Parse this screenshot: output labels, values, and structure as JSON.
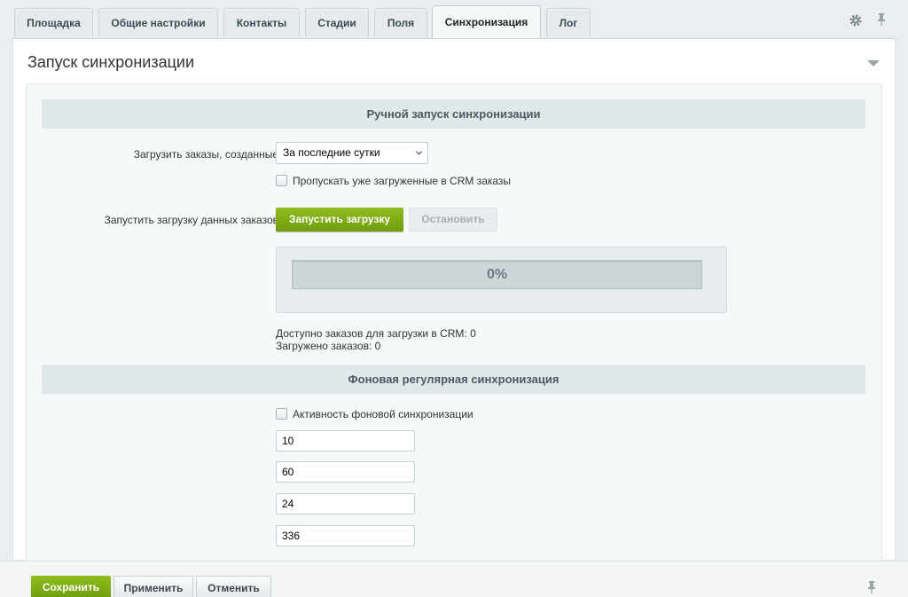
{
  "tabs": [
    {
      "label": "Площадка",
      "active": false
    },
    {
      "label": "Общие настройки",
      "active": false
    },
    {
      "label": "Контакты",
      "active": false
    },
    {
      "label": "Стадии",
      "active": false
    },
    {
      "label": "Поля",
      "active": false
    },
    {
      "label": "Синхронизация",
      "active": true
    },
    {
      "label": "Лог",
      "active": false
    }
  ],
  "toolbar": {
    "settings_icon": "gear-icon",
    "pin_icon": "pin-icon"
  },
  "panel": {
    "title": "Запуск синхронизации",
    "collapse_icon": "chevron-down-icon"
  },
  "manual": {
    "header": "Ручной запуск синхронизации",
    "orders_label": "Загрузить заказы, созданные",
    "orders_select_value": "За последние сутки",
    "skip_loaded_label": "Пропускать уже загруженные в CRM заказы",
    "skip_loaded_checked": false,
    "start_label": "Запустить загрузку данных заказов",
    "start_button": "Запустить загрузку",
    "stop_button": "Остановить",
    "progress_text": "0%",
    "progress_value": 0,
    "available_text": "Доступно заказов для загрузки в CRM: 0",
    "loaded_text": "Загружено заказов: 0"
  },
  "background": {
    "header": "Фоновая регулярная синхронизация",
    "active_label": "Активность фоновой синхронизации",
    "active_checked": false,
    "inputs": [
      "10",
      "60",
      "24",
      "336"
    ]
  },
  "footer": {
    "save": "Сохранить",
    "apply": "Применить",
    "cancel": "Отменить"
  },
  "colors": {
    "accent_green": "#7aa813",
    "background": "#e9eef0",
    "section_header": "#e0e8ea"
  }
}
